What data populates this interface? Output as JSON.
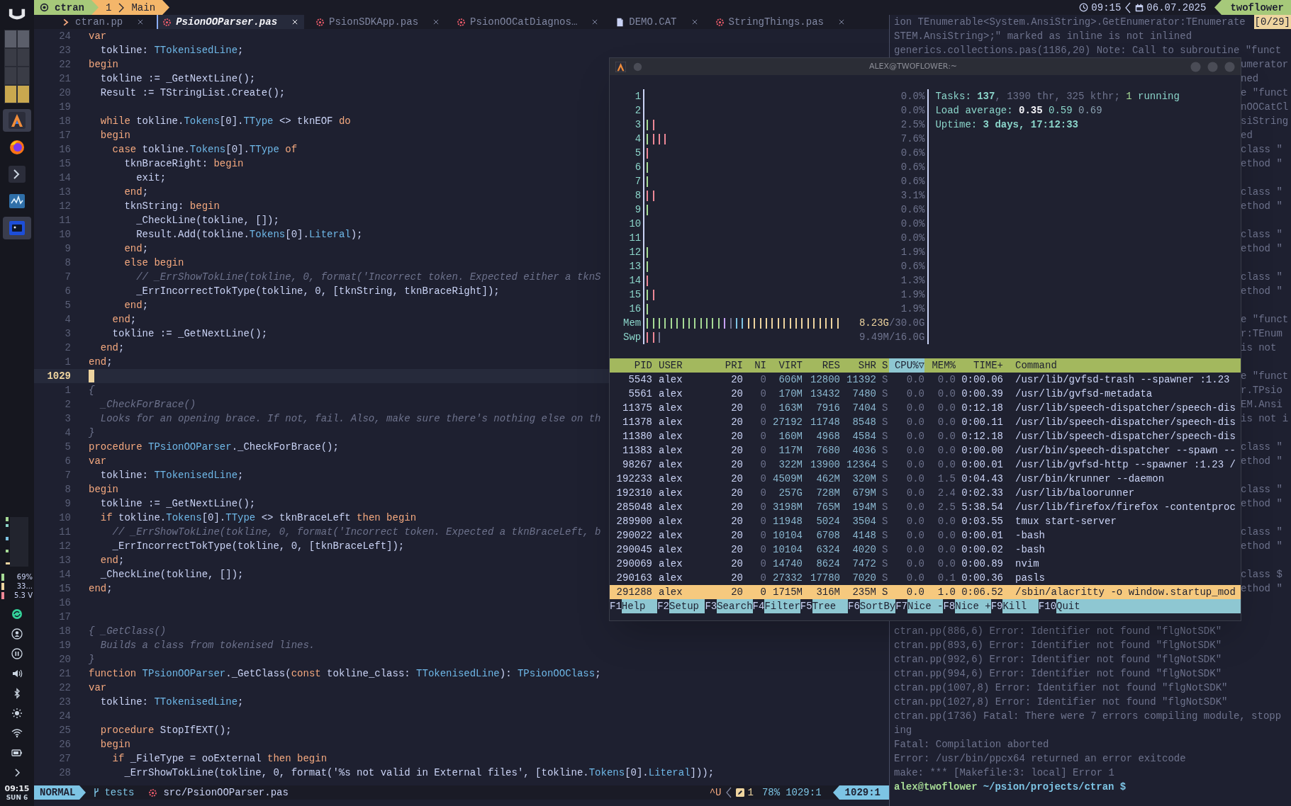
{
  "top_bar": {
    "session": "ctran",
    "window_index": "1",
    "window_name": "Main",
    "time": "09:15",
    "date": "06.07.2025",
    "host": "twoflower"
  },
  "dock": {
    "workspaces": [
      {
        "selected": false
      },
      {
        "selected": false
      },
      {
        "selected": false
      },
      {
        "selected": false
      },
      {
        "selected": false
      },
      {
        "selected": false
      },
      {
        "selected": true
      },
      {
        "selected": true
      }
    ],
    "apps": [
      {
        "kind": "alacritty",
        "selected": true
      },
      {
        "kind": "browser",
        "selected": false
      },
      {
        "kind": "prompt",
        "selected": false
      },
      {
        "kind": "monitor",
        "selected": false
      },
      {
        "kind": "window",
        "selected": true
      }
    ],
    "readings": [
      "69%",
      "33...",
      "5.3 V"
    ],
    "clock": "09:15",
    "day": "SUN 6"
  },
  "editor": {
    "tabs": [
      {
        "label": "ctran.pp",
        "kind": "program",
        "selected": false
      },
      {
        "label": "PsionOOParser.pas",
        "kind": "pascal",
        "selected": true
      },
      {
        "label": "PsionSDKApp.pas",
        "kind": "pascal",
        "selected": false
      },
      {
        "label": "PsionOOCatDiagnos…",
        "kind": "pascal",
        "selected": false
      },
      {
        "label": "DEMO.CAT",
        "kind": "file",
        "selected": false
      },
      {
        "label": "StringThings.pas",
        "kind": "pascal",
        "selected": false
      }
    ],
    "lines": [
      {
        "number": "24",
        "current": false,
        "code": [
          {
            "text": "var",
            "kind": "kw"
          }
        ]
      },
      {
        "number": "23",
        "current": false,
        "code": [
          {
            "text": "  tokline: "
          },
          {
            "text": "TTokenisedLine",
            "kind": "ty"
          },
          {
            "text": ";"
          }
        ]
      },
      {
        "number": "22",
        "current": false,
        "code": [
          {
            "text": "begin",
            "kind": "kw"
          }
        ]
      },
      {
        "number": "21",
        "current": false,
        "code": [
          {
            "text": "  tokline := _GetNextLine();"
          }
        ]
      },
      {
        "number": "20",
        "current": false,
        "code": [
          {
            "text": "  Result := TStringList.Create();"
          }
        ]
      },
      {
        "number": "19",
        "current": false
      },
      {
        "number": "18",
        "current": false,
        "code": [
          {
            "text": "  while",
            "kind": "kw"
          },
          {
            "text": " tokline."
          },
          {
            "text": "Tokens",
            "kind": "ty"
          },
          {
            "text": "[0]."
          },
          {
            "text": "TType",
            "kind": "ty"
          },
          {
            "text": " <> tknEOF "
          },
          {
            "text": "do",
            "kind": "kw"
          }
        ]
      },
      {
        "number": "17",
        "current": false,
        "code": [
          {
            "text": "  begin",
            "kind": "kw"
          }
        ]
      },
      {
        "number": "16",
        "current": false,
        "code": [
          {
            "text": "    case",
            "kind": "kw"
          },
          {
            "text": " tokline."
          },
          {
            "text": "Tokens",
            "kind": "ty"
          },
          {
            "text": "[0]."
          },
          {
            "text": "TType",
            "kind": "ty"
          },
          {
            "text": " of",
            "kind": "kw"
          }
        ]
      },
      {
        "number": "15",
        "current": false,
        "code": [
          {
            "text": "      tknBraceRight: "
          },
          {
            "text": "begin",
            "kind": "kw"
          }
        ]
      },
      {
        "number": "14",
        "current": false,
        "code": [
          {
            "text": "        exit;"
          }
        ]
      },
      {
        "number": "13",
        "current": false,
        "code": [
          {
            "text": "      end",
            "kind": "kw"
          },
          {
            "text": ";"
          }
        ]
      },
      {
        "number": "12",
        "current": false,
        "code": [
          {
            "text": "      tknString: "
          },
          {
            "text": "begin",
            "kind": "kw"
          }
        ]
      },
      {
        "number": "11",
        "current": false,
        "code": [
          {
            "text": "        _CheckLine(tokline, []);"
          }
        ]
      },
      {
        "number": "10",
        "current": false,
        "code": [
          {
            "text": "        Result.Add(tokline."
          },
          {
            "text": "Tokens",
            "kind": "ty"
          },
          {
            "text": "[0]."
          },
          {
            "text": "Literal",
            "kind": "ty"
          },
          {
            "text": ");"
          }
        ]
      },
      {
        "number": "9",
        "current": false,
        "code": [
          {
            "text": "      end",
            "kind": "kw"
          },
          {
            "text": ";"
          }
        ]
      },
      {
        "number": "8",
        "current": false,
        "code": [
          {
            "text": "      else begin",
            "kind": "kw"
          }
        ]
      },
      {
        "number": "7",
        "current": false,
        "code": [
          {
            "text": "        // _ErrShowTokLine(tokline, 0, format('Incorrect token. Expected either a tknS",
            "kind": "cm"
          }
        ]
      },
      {
        "number": "6",
        "current": false,
        "code": [
          {
            "text": "        _ErrIncorrectTokType(tokline, 0, [tknString, tknBraceRight]);"
          }
        ]
      },
      {
        "number": "5",
        "current": false,
        "code": [
          {
            "text": "      end",
            "kind": "kw"
          },
          {
            "text": ";"
          }
        ]
      },
      {
        "number": "4",
        "current": false,
        "code": [
          {
            "text": "    end",
            "kind": "kw"
          },
          {
            "text": ";"
          }
        ]
      },
      {
        "number": "3",
        "current": false,
        "code": [
          {
            "text": "    tokline := _GetNextLine();"
          }
        ]
      },
      {
        "number": "2",
        "current": false,
        "code": [
          {
            "text": "  end",
            "kind": "kw"
          },
          {
            "text": ";"
          }
        ]
      },
      {
        "number": "1",
        "current": false,
        "code": [
          {
            "text": "end",
            "kind": "kw"
          },
          {
            "text": ";"
          }
        ]
      },
      {
        "number": "1029",
        "current": true
      },
      {
        "number": "1",
        "current": false,
        "code": [
          {
            "text": "{",
            "kind": "cm"
          }
        ]
      },
      {
        "number": "2",
        "current": false,
        "code": [
          {
            "text": "  _CheckForBrace()",
            "kind": "cm"
          }
        ]
      },
      {
        "number": "3",
        "current": false,
        "code": [
          {
            "text": "  Looks for an opening brace. If not, fail. Also, make sure there's nothing else on th",
            "kind": "cm"
          }
        ]
      },
      {
        "number": "4",
        "current": false,
        "code": [
          {
            "text": "}",
            "kind": "cm"
          }
        ]
      },
      {
        "number": "5",
        "current": false,
        "code": [
          {
            "text": "procedure",
            "kind": "kw"
          },
          {
            "text": " TPsionOOParser",
            "kind": "ty"
          },
          {
            "text": "._CheckForBrace();"
          }
        ]
      },
      {
        "number": "6",
        "current": false,
        "code": [
          {
            "text": "var",
            "kind": "kw"
          }
        ]
      },
      {
        "number": "7",
        "current": false,
        "code": [
          {
            "text": "  tokline: "
          },
          {
            "text": "TTokenisedLine",
            "kind": "ty"
          },
          {
            "text": ";"
          }
        ]
      },
      {
        "number": "8",
        "current": false,
        "code": [
          {
            "text": "begin",
            "kind": "kw"
          }
        ]
      },
      {
        "number": "9",
        "current": false,
        "code": [
          {
            "text": "  tokline := _GetNextLine();"
          }
        ]
      },
      {
        "number": "10",
        "current": false,
        "code": [
          {
            "text": "  if",
            "kind": "kw"
          },
          {
            "text": " tokline."
          },
          {
            "text": "Tokens",
            "kind": "ty"
          },
          {
            "text": "[0]."
          },
          {
            "text": "TType",
            "kind": "ty"
          },
          {
            "text": " <> tknBraceLeft "
          },
          {
            "text": "then begin",
            "kind": "kw"
          }
        ]
      },
      {
        "number": "11",
        "current": false,
        "code": [
          {
            "text": "    // _ErrShowTokLine(tokline, 0, format('Incorrect token. Expected a tknBraceLeft, b",
            "kind": "cm"
          }
        ]
      },
      {
        "number": "12",
        "current": false,
        "code": [
          {
            "text": "    _ErrIncorrectTokType(tokline, 0, [tknBraceLeft]);"
          }
        ]
      },
      {
        "number": "13",
        "current": false,
        "code": [
          {
            "text": "  end",
            "kind": "kw"
          },
          {
            "text": ";"
          }
        ]
      },
      {
        "number": "14",
        "current": false,
        "code": [
          {
            "text": "  _CheckLine(tokline, []);"
          }
        ]
      },
      {
        "number": "15",
        "current": false,
        "code": [
          {
            "text": "end",
            "kind": "kw"
          },
          {
            "text": ";"
          }
        ]
      },
      {
        "number": "16",
        "current": false
      },
      {
        "number": "17",
        "current": false
      },
      {
        "number": "18",
        "current": false,
        "code": [
          {
            "text": "{ _GetClass()",
            "kind": "cm"
          }
        ]
      },
      {
        "number": "19",
        "current": false,
        "code": [
          {
            "text": "  Builds a class from tokenised lines.",
            "kind": "cm"
          }
        ]
      },
      {
        "number": "20",
        "current": false,
        "code": [
          {
            "text": "}",
            "kind": "cm"
          }
        ]
      },
      {
        "number": "21",
        "current": false,
        "code": [
          {
            "text": "function",
            "kind": "kw"
          },
          {
            "text": " TPsionOOParser",
            "kind": "ty"
          },
          {
            "text": "._GetClass("
          },
          {
            "text": "const",
            "kind": "kw"
          },
          {
            "text": " tokline_class: "
          },
          {
            "text": "TTokenisedLine",
            "kind": "ty"
          },
          {
            "text": "): "
          },
          {
            "text": "TPsionOOClass",
            "kind": "ty"
          },
          {
            "text": ";"
          }
        ]
      },
      {
        "number": "22",
        "current": false,
        "code": [
          {
            "text": "var",
            "kind": "kw"
          }
        ]
      },
      {
        "number": "23",
        "current": false,
        "code": [
          {
            "text": "  tokline: "
          },
          {
            "text": "TTokenisedLine",
            "kind": "ty"
          },
          {
            "text": ";"
          }
        ]
      },
      {
        "number": "24",
        "current": false
      },
      {
        "number": "25",
        "current": false,
        "code": [
          {
            "text": "  procedure",
            "kind": "kw"
          },
          {
            "text": " StopIfEXT();"
          }
        ]
      },
      {
        "number": "26",
        "current": false,
        "code": [
          {
            "text": "  begin",
            "kind": "kw"
          }
        ]
      },
      {
        "number": "27",
        "current": false,
        "code": [
          {
            "text": "    if",
            "kind": "kw"
          },
          {
            "text": " _FileType = ooExternal "
          },
          {
            "text": "then begin",
            "kind": "kw"
          }
        ]
      },
      {
        "number": "28",
        "current": false,
        "code": [
          {
            "text": "      _ErrShowTokLine(tokline, 0, format('%s not valid in External files', [tokline."
          },
          {
            "text": "Tokens",
            "kind": "ty"
          },
          {
            "text": "[0]."
          },
          {
            "text": "Literal",
            "kind": "ty"
          },
          {
            "text": "]));"
          }
        ]
      }
    ],
    "status": {
      "mode": "NORMAL",
      "branch": "tests",
      "file": "src/PsionOOParser.pas",
      "keys": "^U",
      "diagnostics": "1",
      "percent": "78%",
      "position": "1029:1",
      "position_pill": "1029:1"
    }
  },
  "terminal": {
    "badge": "[0/29]",
    "lines": [
      {
        "kind": "text",
        "text": "ion TEnumerable<System.AnsiString>.GetEnumerator:TEnumerate",
        "covered": false
      },
      {
        "kind": "text",
        "text": "STEM.AnsiString>;\" marked as inline is not inlined",
        "covered": false
      },
      {
        "kind": "text",
        "text": "generics.collections.pas(1186,20) Note: Call to subroutine \"funct",
        "covered": false
      },
      {
        "kind": "text",
        "text": "umerator",
        "covered": true
      },
      {
        "kind": "text",
        "text": "ned",
        "covered": true
      },
      {
        "kind": "text",
        "text": "e \"funct",
        "covered": true
      },
      {
        "kind": "text",
        "text": "nOOCatCl",
        "covered": true
      },
      {
        "kind": "text",
        "text": "siString",
        "covered": true
      },
      {
        "kind": "text",
        "text": "ed",
        "covered": true
      },
      {
        "kind": "text",
        "text": "class \"",
        "covered": true
      },
      {
        "kind": "text",
        "text": "ethod \"",
        "covered": true
      },
      {
        "kind": "blank"
      },
      {
        "kind": "text",
        "text": "class \"",
        "covered": true
      },
      {
        "kind": "text",
        "text": "ethod \"",
        "covered": true
      },
      {
        "kind": "blank"
      },
      {
        "kind": "text",
        "text": "class \"",
        "covered": true
      },
      {
        "kind": "text",
        "text": "ethod \"",
        "covered": true
      },
      {
        "kind": "blank"
      },
      {
        "kind": "text",
        "text": "class \"",
        "covered": true
      },
      {
        "kind": "text",
        "text": "ethod \"",
        "covered": true
      },
      {
        "kind": "blank"
      },
      {
        "kind": "text",
        "text": "e \"funct",
        "covered": true
      },
      {
        "kind": "text",
        "text": "r:TEnum",
        "covered": true
      },
      {
        "kind": "text",
        "text": "is not",
        "covered": true
      },
      {
        "kind": "blank"
      },
      {
        "kind": "text",
        "text": "e \"funct",
        "covered": true
      },
      {
        "kind": "text",
        "text": "r.TPsio",
        "covered": true
      },
      {
        "kind": "text",
        "text": "EM.Ansi",
        "covered": true
      },
      {
        "kind": "text",
        "text": "is not i",
        "covered": true
      },
      {
        "kind": "blank"
      },
      {
        "kind": "text",
        "text": "class \"",
        "covered": true
      },
      {
        "kind": "text",
        "text": "ethod \"",
        "covered": true
      },
      {
        "kind": "blank"
      },
      {
        "kind": "text",
        "text": "class \"",
        "covered": true
      },
      {
        "kind": "text",
        "text": "ethod \"",
        "covered": true
      },
      {
        "kind": "blank"
      },
      {
        "kind": "text",
        "text": "class \"",
        "covered": true
      },
      {
        "kind": "text",
        "text": "ethod \"",
        "covered": true
      },
      {
        "kind": "blank"
      },
      {
        "kind": "text",
        "text": "class $",
        "covered": true
      },
      {
        "kind": "text",
        "text": "ethod \"",
        "covered": true
      },
      {
        "kind": "blank"
      },
      {
        "kind": "blank"
      },
      {
        "kind": "text",
        "text": "ctran.pp(886,6) Error: Identifier not found \"flgNotSDK\"",
        "covered": false
      },
      {
        "kind": "text",
        "text": "ctran.pp(893,6) Error: Identifier not found \"flgNotSDK\"",
        "covered": false
      },
      {
        "kind": "text",
        "text": "ctran.pp(992,6) Error: Identifier not found \"flgNotSDK\"",
        "covered": false
      },
      {
        "kind": "text",
        "text": "ctran.pp(994,6) Error: Identifier not found \"flgNotSDK\"",
        "covered": false
      },
      {
        "kind": "text",
        "text": "ctran.pp(1007,8) Error: Identifier not found \"flgNotSDK\"",
        "covered": false
      },
      {
        "kind": "text",
        "text": "ctran.pp(1027,8) Error: Identifier not found \"flgNotSDK\"",
        "covered": false
      },
      {
        "kind": "text",
        "text": "ctran.pp(1736) Fatal: There were 7 errors compiling module, stopp",
        "covered": false
      },
      {
        "kind": "text",
        "text": "ing",
        "covered": false
      },
      {
        "kind": "text",
        "text": "Fatal: Compilation aborted",
        "covered": false
      },
      {
        "kind": "text",
        "text": "Error: /usr/bin/ppcx64 returned an error exitcode",
        "covered": false
      },
      {
        "kind": "text",
        "text": "make: *** [Makefile:3: local] Error 1",
        "covered": false
      }
    ],
    "prompt": {
      "user": "alex@twoflower",
      "path": "~/psion/projects/ctran $"
    }
  },
  "htop": {
    "title": "ALEX@TWOFLOWER:~",
    "cpus": [
      {
        "label": "1",
        "reading": "0.0%"
      },
      {
        "label": "2",
        "reading": "0.0%"
      },
      {
        "label": "3",
        "reading": "2.5%"
      },
      {
        "label": "4",
        "reading": "7.6%"
      },
      {
        "label": "5",
        "reading": "0.6%"
      },
      {
        "label": "6",
        "reading": "0.6%"
      },
      {
        "label": "7",
        "reading": "0.6%"
      },
      {
        "label": "8",
        "reading": "3.1%"
      },
      {
        "label": "9",
        "reading": "0.6%"
      },
      {
        "label": "10",
        "reading": "0.0%"
      },
      {
        "label": "11",
        "reading": "0.0%"
      },
      {
        "label": "12",
        "reading": "1.9%"
      },
      {
        "label": "13",
        "reading": "0.6%"
      },
      {
        "label": "14",
        "reading": "1.3%"
      },
      {
        "label": "15",
        "reading": "1.9%"
      },
      {
        "label": "16",
        "reading": "1.9%"
      }
    ],
    "mem": {
      "label": "Mem",
      "used": "8.23G",
      "total": "/30.0G"
    },
    "swap": {
      "label": "Swp",
      "reading": "9.49M/16.0G"
    },
    "tasks": {
      "label": "Tasks:",
      "count": "137",
      "threads": ", 1390 thr, 325 kthr;",
      "running_count": "1",
      "running": "running"
    },
    "load": {
      "label": "Load average:",
      "values": [
        "0.35",
        "0.59",
        "0.69"
      ]
    },
    "uptime": {
      "label": "Uptime:",
      "value": "3 days, 17:12:33"
    },
    "columns": [
      {
        "label": "PID",
        "selected": false
      },
      {
        "label": "USER",
        "selected": false
      },
      {
        "label": "PRI",
        "selected": false
      },
      {
        "label": "NI",
        "selected": false
      },
      {
        "label": "VIRT",
        "selected": false
      },
      {
        "label": "RES",
        "selected": false
      },
      {
        "label": "SHR",
        "selected": false
      },
      {
        "label": "S",
        "selected": false
      },
      {
        "label": "CPU%▽",
        "selected": true
      },
      {
        "label": "MEM%",
        "selected": false
      },
      {
        "label": "TIME+",
        "selected": false
      },
      {
        "label": "Command",
        "selected": false
      }
    ],
    "processes": [
      {
        "cells": [
          "5543",
          "alex",
          "20",
          "0",
          "606M",
          "12800",
          "11392",
          "S",
          "0.0",
          "0.0",
          "0:00.06",
          "/usr/lib/gvfsd-trash --spawner :1.23"
        ],
        "selected": false
      },
      {
        "cells": [
          "5561",
          "alex",
          "20",
          "0",
          "170M",
          "13432",
          "7480",
          "S",
          "0.0",
          "0.0",
          "0:00.39",
          "/usr/lib/gvfsd-metadata"
        ],
        "selected": false
      },
      {
        "cells": [
          "11375",
          "alex",
          "20",
          "0",
          "163M",
          "7916",
          "7404",
          "S",
          "0.0",
          "0.0",
          "0:12.18",
          "/usr/lib/speech-dispatcher/speech-dis"
        ],
        "selected": false
      },
      {
        "cells": [
          "11378",
          "alex",
          "20",
          "0",
          "27192",
          "11748",
          "8548",
          "S",
          "0.0",
          "0.0",
          "0:00.11",
          "/usr/lib/speech-dispatcher/speech-dis"
        ],
        "selected": false
      },
      {
        "cells": [
          "11380",
          "alex",
          "20",
          "0",
          "160M",
          "4968",
          "4584",
          "S",
          "0.0",
          "0.0",
          "0:12.18",
          "/usr/lib/speech-dispatcher/speech-dis"
        ],
        "selected": false
      },
      {
        "cells": [
          "11383",
          "alex",
          "20",
          "0",
          "117M",
          "7680",
          "4036",
          "S",
          "0.0",
          "0.0",
          "0:00.00",
          "/usr/bin/speech-dispatcher --spawn --"
        ],
        "selected": false
      },
      {
        "cells": [
          "98267",
          "alex",
          "20",
          "0",
          "322M",
          "13900",
          "12364",
          "S",
          "0.0",
          "0.0",
          "0:00.01",
          "/usr/lib/gvfsd-http --spawner :1.23 /"
        ],
        "selected": false
      },
      {
        "cells": [
          "192233",
          "alex",
          "20",
          "0",
          "4509M",
          "462M",
          "320M",
          "S",
          "0.0",
          "1.5",
          "0:04.43",
          "/usr/bin/krunner --daemon"
        ],
        "selected": false
      },
      {
        "cells": [
          "192310",
          "alex",
          "20",
          "0",
          "257G",
          "728M",
          "679M",
          "S",
          "0.0",
          "2.4",
          "0:02.33",
          "/usr/lib/baloorunner"
        ],
        "selected": false
      },
      {
        "cells": [
          "285048",
          "alex",
          "20",
          "0",
          "3198M",
          "765M",
          "194M",
          "S",
          "0.0",
          "2.5",
          "5:38.54",
          "/usr/lib/firefox/firefox -contentproc"
        ],
        "selected": false
      },
      {
        "cells": [
          "289900",
          "alex",
          "20",
          "0",
          "11948",
          "5024",
          "3504",
          "S",
          "0.0",
          "0.0",
          "0:03.55",
          "tmux start-server"
        ],
        "selected": false
      },
      {
        "cells": [
          "290022",
          "alex",
          "20",
          "0",
          "10104",
          "6708",
          "4148",
          "S",
          "0.0",
          "0.0",
          "0:00.01",
          "-bash"
        ],
        "selected": false
      },
      {
        "cells": [
          "290045",
          "alex",
          "20",
          "0",
          "10104",
          "6324",
          "4020",
          "S",
          "0.0",
          "0.0",
          "0:00.02",
          "-bash"
        ],
        "selected": false
      },
      {
        "cells": [
          "290069",
          "alex",
          "20",
          "0",
          "14740",
          "8624",
          "7472",
          "S",
          "0.0",
          "0.0",
          "0:00.89",
          "nvim"
        ],
        "selected": false
      },
      {
        "cells": [
          "290163",
          "alex",
          "20",
          "0",
          "27332",
          "17780",
          "7020",
          "S",
          "0.0",
          "0.1",
          "0:00.36",
          "pasls"
        ],
        "selected": false
      },
      {
        "cells": [
          "291288",
          "alex",
          "20",
          "0",
          "1715M",
          "316M",
          "235M",
          "S",
          "0.0",
          "1.0",
          "0:06.52",
          "/sbin/alacritty -o window.startup_mod"
        ],
        "selected": true
      }
    ],
    "function_keys": [
      {
        "key": "F1",
        "label": "Help"
      },
      {
        "key": "F2",
        "label": "Setup"
      },
      {
        "key": "F3",
        "label": "Search"
      },
      {
        "key": "F4",
        "label": "Filter"
      },
      {
        "key": "F5",
        "label": "Tree"
      },
      {
        "key": "F6",
        "label": "SortBy"
      },
      {
        "key": "F7",
        "label": "Nice -"
      },
      {
        "key": "F8",
        "label": "Nice +"
      },
      {
        "key": "F9",
        "label": "Kill"
      },
      {
        "key": "F10",
        "label": "Quit"
      }
    ]
  }
}
